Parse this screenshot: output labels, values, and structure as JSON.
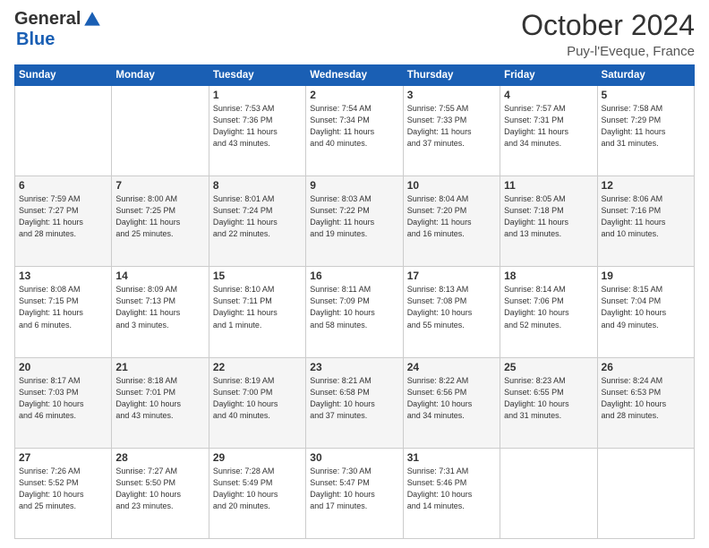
{
  "header": {
    "logo_general": "General",
    "logo_blue": "Blue",
    "month": "October 2024",
    "location": "Puy-l'Eveque, France"
  },
  "days_of_week": [
    "Sunday",
    "Monday",
    "Tuesday",
    "Wednesday",
    "Thursday",
    "Friday",
    "Saturday"
  ],
  "weeks": [
    [
      {
        "day": "",
        "info": ""
      },
      {
        "day": "",
        "info": ""
      },
      {
        "day": "1",
        "info": "Sunrise: 7:53 AM\nSunset: 7:36 PM\nDaylight: 11 hours\nand 43 minutes."
      },
      {
        "day": "2",
        "info": "Sunrise: 7:54 AM\nSunset: 7:34 PM\nDaylight: 11 hours\nand 40 minutes."
      },
      {
        "day": "3",
        "info": "Sunrise: 7:55 AM\nSunset: 7:33 PM\nDaylight: 11 hours\nand 37 minutes."
      },
      {
        "day": "4",
        "info": "Sunrise: 7:57 AM\nSunset: 7:31 PM\nDaylight: 11 hours\nand 34 minutes."
      },
      {
        "day": "5",
        "info": "Sunrise: 7:58 AM\nSunset: 7:29 PM\nDaylight: 11 hours\nand 31 minutes."
      }
    ],
    [
      {
        "day": "6",
        "info": "Sunrise: 7:59 AM\nSunset: 7:27 PM\nDaylight: 11 hours\nand 28 minutes."
      },
      {
        "day": "7",
        "info": "Sunrise: 8:00 AM\nSunset: 7:25 PM\nDaylight: 11 hours\nand 25 minutes."
      },
      {
        "day": "8",
        "info": "Sunrise: 8:01 AM\nSunset: 7:24 PM\nDaylight: 11 hours\nand 22 minutes."
      },
      {
        "day": "9",
        "info": "Sunrise: 8:03 AM\nSunset: 7:22 PM\nDaylight: 11 hours\nand 19 minutes."
      },
      {
        "day": "10",
        "info": "Sunrise: 8:04 AM\nSunset: 7:20 PM\nDaylight: 11 hours\nand 16 minutes."
      },
      {
        "day": "11",
        "info": "Sunrise: 8:05 AM\nSunset: 7:18 PM\nDaylight: 11 hours\nand 13 minutes."
      },
      {
        "day": "12",
        "info": "Sunrise: 8:06 AM\nSunset: 7:16 PM\nDaylight: 11 hours\nand 10 minutes."
      }
    ],
    [
      {
        "day": "13",
        "info": "Sunrise: 8:08 AM\nSunset: 7:15 PM\nDaylight: 11 hours\nand 6 minutes."
      },
      {
        "day": "14",
        "info": "Sunrise: 8:09 AM\nSunset: 7:13 PM\nDaylight: 11 hours\nand 3 minutes."
      },
      {
        "day": "15",
        "info": "Sunrise: 8:10 AM\nSunset: 7:11 PM\nDaylight: 11 hours\nand 1 minute."
      },
      {
        "day": "16",
        "info": "Sunrise: 8:11 AM\nSunset: 7:09 PM\nDaylight: 10 hours\nand 58 minutes."
      },
      {
        "day": "17",
        "info": "Sunrise: 8:13 AM\nSunset: 7:08 PM\nDaylight: 10 hours\nand 55 minutes."
      },
      {
        "day": "18",
        "info": "Sunrise: 8:14 AM\nSunset: 7:06 PM\nDaylight: 10 hours\nand 52 minutes."
      },
      {
        "day": "19",
        "info": "Sunrise: 8:15 AM\nSunset: 7:04 PM\nDaylight: 10 hours\nand 49 minutes."
      }
    ],
    [
      {
        "day": "20",
        "info": "Sunrise: 8:17 AM\nSunset: 7:03 PM\nDaylight: 10 hours\nand 46 minutes."
      },
      {
        "day": "21",
        "info": "Sunrise: 8:18 AM\nSunset: 7:01 PM\nDaylight: 10 hours\nand 43 minutes."
      },
      {
        "day": "22",
        "info": "Sunrise: 8:19 AM\nSunset: 7:00 PM\nDaylight: 10 hours\nand 40 minutes."
      },
      {
        "day": "23",
        "info": "Sunrise: 8:21 AM\nSunset: 6:58 PM\nDaylight: 10 hours\nand 37 minutes."
      },
      {
        "day": "24",
        "info": "Sunrise: 8:22 AM\nSunset: 6:56 PM\nDaylight: 10 hours\nand 34 minutes."
      },
      {
        "day": "25",
        "info": "Sunrise: 8:23 AM\nSunset: 6:55 PM\nDaylight: 10 hours\nand 31 minutes."
      },
      {
        "day": "26",
        "info": "Sunrise: 8:24 AM\nSunset: 6:53 PM\nDaylight: 10 hours\nand 28 minutes."
      }
    ],
    [
      {
        "day": "27",
        "info": "Sunrise: 7:26 AM\nSunset: 5:52 PM\nDaylight: 10 hours\nand 25 minutes."
      },
      {
        "day": "28",
        "info": "Sunrise: 7:27 AM\nSunset: 5:50 PM\nDaylight: 10 hours\nand 23 minutes."
      },
      {
        "day": "29",
        "info": "Sunrise: 7:28 AM\nSunset: 5:49 PM\nDaylight: 10 hours\nand 20 minutes."
      },
      {
        "day": "30",
        "info": "Sunrise: 7:30 AM\nSunset: 5:47 PM\nDaylight: 10 hours\nand 17 minutes."
      },
      {
        "day": "31",
        "info": "Sunrise: 7:31 AM\nSunset: 5:46 PM\nDaylight: 10 hours\nand 14 minutes."
      },
      {
        "day": "",
        "info": ""
      },
      {
        "day": "",
        "info": ""
      }
    ]
  ]
}
